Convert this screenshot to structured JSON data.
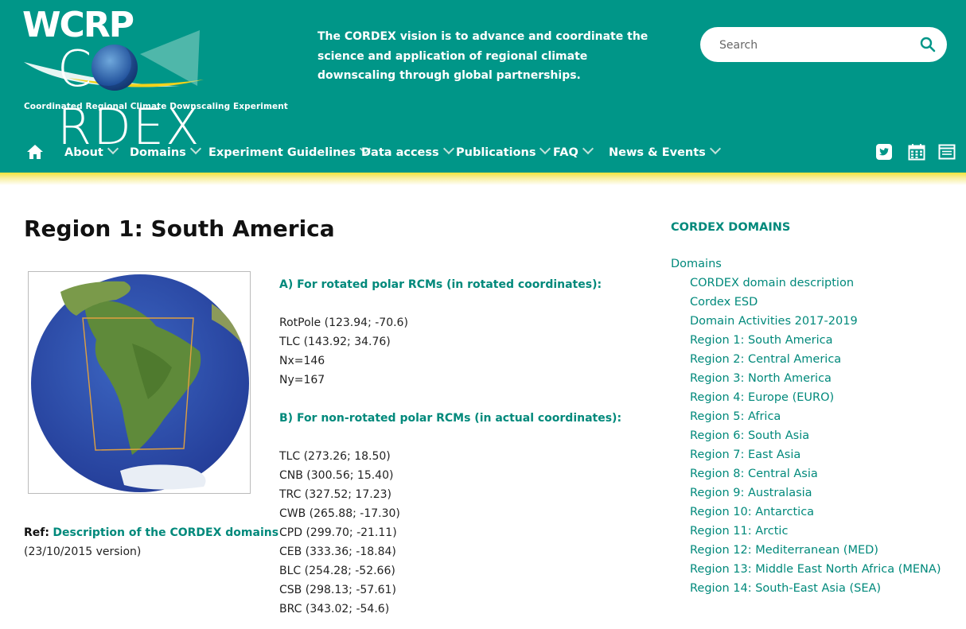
{
  "brand": {
    "logo_top": "WCRP",
    "logo_main": "CORDEX",
    "tagline": "Coordinated Regional Climate Downscaling Experiment"
  },
  "vision_text": "The CORDEX vision is to advance and coordinate the science and application of regional climate downscaling through global partnerships.",
  "search": {
    "placeholder": "Search",
    "icon": "search-icon"
  },
  "nav": {
    "home_icon": "home-icon",
    "items": [
      {
        "label": "About"
      },
      {
        "label": "Domains"
      },
      {
        "label": "Experiment Guidelines"
      },
      {
        "label": "Data access"
      },
      {
        "label": "Publications"
      },
      {
        "label": "FAQ"
      },
      {
        "label": "News & Events"
      }
    ],
    "social_icons": [
      "twitter-icon",
      "calendar-icon",
      "newsletter-icon"
    ]
  },
  "page": {
    "title": "Region 1: South America",
    "ref_label": "Ref:",
    "ref_link": "Description of the CORDEX domains",
    "ref_version": "(23/10/2015 version)",
    "section_a": {
      "heading": "A) For rotated polar RCMs (in rotated coordinates):",
      "lines": [
        "RotPole (123.94; -70.6)",
        "TLC (143.92; 34.76)",
        "Nx=146",
        "Ny=167"
      ]
    },
    "section_b": {
      "heading": "B) For non-rotated polar RCMs (in actual coordinates):",
      "lines": [
        "TLC (273.26; 18.50)",
        "CNB (300.56; 15.40)",
        "TRC (327.52; 17.23)",
        "CWB (265.88; -17.30)",
        "CPD (299.70; -21.11)",
        "CEB (333.36; -18.84)",
        "BLC (254.28; -52.66)",
        "CSB (298.13; -57.61)",
        "BRC (343.02; -54.6)"
      ]
    }
  },
  "sidebar": {
    "title": "CORDEX DOMAINS",
    "root": "Domains",
    "items": [
      "CORDEX domain description",
      "Cordex ESD",
      "Domain Activities 2017-2019",
      "Region 1: South America",
      "Region 2: Central America",
      "Region 3: North America",
      "Region 4: Europe (EURO)",
      "Region 5: Africa",
      "Region 6: South Asia",
      "Region 7: East Asia",
      "Region 8: Central Asia",
      "Region 9: Australasia",
      "Region 10: Antarctica",
      "Region 11: Arctic",
      "Region 12: Mediterranean (MED)",
      "Region 13: Middle East North Africa (MENA)",
      "Region 14: South-East Asia (SEA)"
    ]
  },
  "colors": {
    "header_bg": "#009688",
    "accent": "#00897b",
    "stripe": "#f2e33a"
  }
}
